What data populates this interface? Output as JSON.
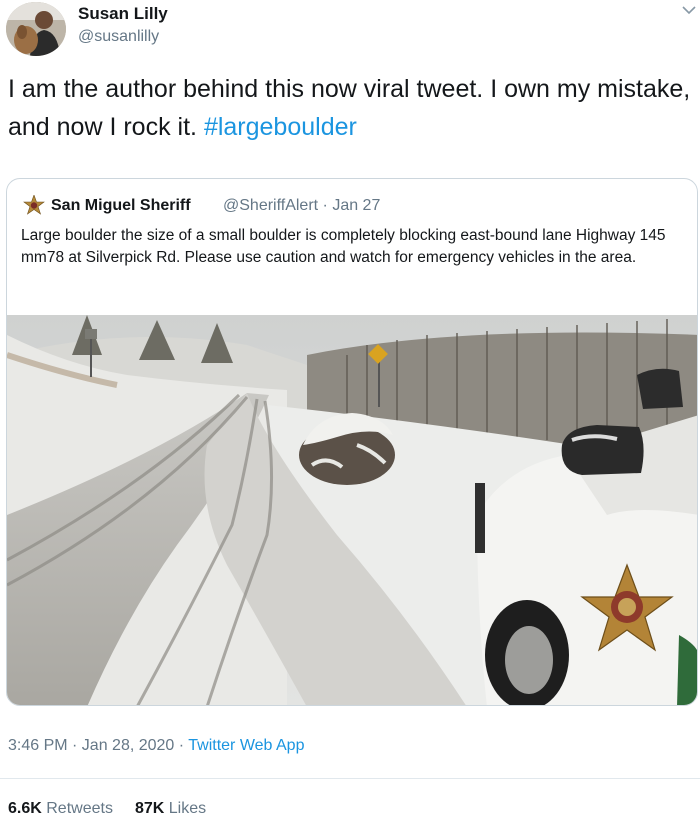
{
  "tweet": {
    "author_name": "Susan Lilly",
    "author_handle": "@susanlilly",
    "text": "I am the author behind this now viral tweet. I own my mistake, and now I rock it.",
    "hashtag": "#largeboulder",
    "timestamp": "3:46 PM · Jan 28, 2020 · ",
    "app": "Twitter Web App",
    "retweet_count": "6.6K",
    "retweet_label": "Retweets",
    "like_count": "87K",
    "like_label": "Likes"
  },
  "quoted_tweet": {
    "author_name": "San Miguel Sheriff",
    "author_handle": "@SheriffAlert · Jan 27",
    "text": "Large boulder the size of a small boulder is completely blocking east-bound lane Highway 145 mm78 at Silverpick Rd. Please use caution and watch for emergency vehicles in the area."
  },
  "icons": {
    "menu": "chevron-down-icon",
    "sheriff_badge": "sheriff-star-icon"
  },
  "colors": {
    "link": "#1b95e0",
    "secondary_text": "#657786",
    "border": "#ccd6dd"
  }
}
